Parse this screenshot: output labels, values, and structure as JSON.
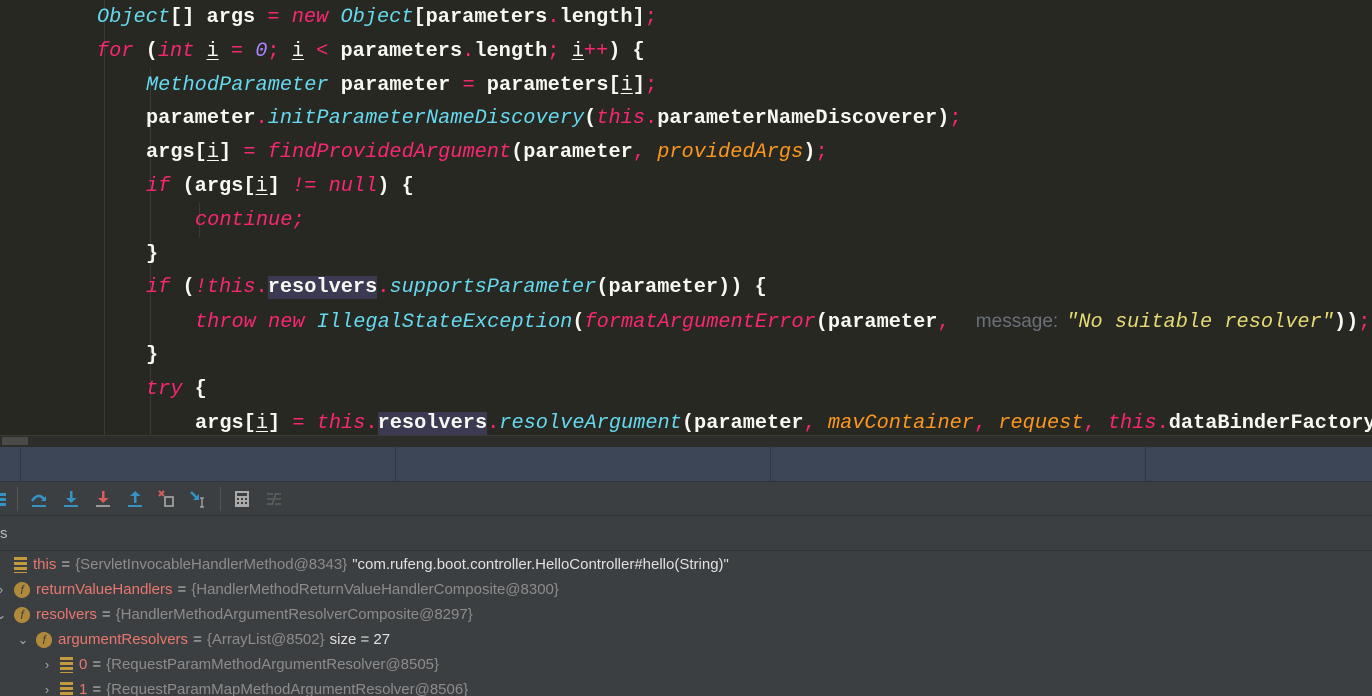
{
  "editor": {
    "lines": [
      {
        "indent": 2,
        "tokens": [
          [
            "t",
            "Object"
          ],
          [
            "",
            "[] args "
          ],
          [
            "o",
            "="
          ],
          [
            "",
            ""
          ],
          [
            "k",
            " new "
          ],
          [
            "t",
            "Object"
          ],
          [
            "",
            "[parameters"
          ],
          [
            "o",
            "."
          ],
          [
            "",
            "length]"
          ],
          [
            "o",
            ";"
          ]
        ]
      },
      {
        "indent": 2,
        "tokens": [
          [
            "k",
            "for"
          ],
          [
            "",
            " ("
          ],
          [
            "k",
            "int "
          ],
          [
            "u",
            "i"
          ],
          [
            "o",
            " = "
          ],
          [
            "n",
            "0"
          ],
          [
            "o",
            "; "
          ],
          [
            "u",
            "i"
          ],
          [
            "o",
            " < "
          ],
          [
            "",
            "parameters"
          ],
          [
            "o",
            "."
          ],
          [
            "",
            "length"
          ],
          [
            "o",
            "; "
          ],
          [
            "u",
            "i"
          ],
          [
            "o",
            "++"
          ],
          [
            "",
            ") {"
          ]
        ]
      },
      {
        "indent": 3,
        "tokens": [
          [
            "t",
            "MethodParameter"
          ],
          [
            "",
            " parameter "
          ],
          [
            "o",
            "="
          ],
          [
            "",
            " parameters["
          ],
          [
            "u",
            "i"
          ],
          [
            "",
            "]"
          ],
          [
            "o",
            ";"
          ]
        ]
      },
      {
        "indent": 3,
        "tokens": [
          [
            "",
            "parameter"
          ],
          [
            "o",
            "."
          ],
          [
            "m",
            "initParameterNameDiscovery"
          ],
          [
            "",
            "("
          ],
          [
            "k",
            "this"
          ],
          [
            "o",
            "."
          ],
          [
            "",
            "parameterNameDiscoverer)"
          ],
          [
            "o",
            ";"
          ]
        ]
      },
      {
        "indent": 3,
        "tokens": [
          [
            "",
            "args["
          ],
          [
            "u",
            "i"
          ],
          [
            "",
            "] "
          ],
          [
            "o",
            "= "
          ],
          [
            "f",
            "findProvidedArgument"
          ],
          [
            "",
            "(parameter"
          ],
          [
            "o",
            ", "
          ],
          [
            "p",
            "providedArgs"
          ],
          [
            "",
            ")"
          ],
          [
            "o",
            ";"
          ]
        ]
      },
      {
        "indent": 3,
        "tokens": [
          [
            "k",
            "if"
          ],
          [
            "",
            " (args["
          ],
          [
            "u",
            "i"
          ],
          [
            "",
            "] "
          ],
          [
            "k",
            "!= null"
          ],
          [
            "",
            ") {"
          ]
        ]
      },
      {
        "indent": 4,
        "tokens": [
          [
            "k",
            "continue;"
          ]
        ]
      },
      {
        "indent": 3,
        "tokens": [
          [
            "",
            "}"
          ]
        ]
      },
      {
        "indent": 3,
        "tokens": [
          [
            "k",
            "if"
          ],
          [
            "",
            " ("
          ],
          [
            "k",
            "!this"
          ],
          [
            "o",
            "."
          ],
          [
            "hl",
            "resolvers"
          ],
          [
            "o",
            "."
          ],
          [
            "m",
            "supportsParameter"
          ],
          [
            "",
            "(parameter)) {"
          ]
        ]
      },
      {
        "indent": 4,
        "tokens": [
          [
            "k",
            "throw new "
          ],
          [
            "t",
            "IllegalStateException"
          ],
          [
            "",
            "("
          ],
          [
            "f",
            "formatArgumentError"
          ],
          [
            "",
            "(parameter"
          ],
          [
            "o",
            ", "
          ],
          [
            "h",
            "message:"
          ],
          [
            "s",
            "\"No suitable resolver\""
          ],
          [
            "",
            "))"
          ],
          [
            "o",
            ";"
          ]
        ]
      },
      {
        "indent": 3,
        "tokens": [
          [
            "",
            "}"
          ]
        ]
      },
      {
        "indent": 3,
        "tokens": [
          [
            "k",
            "try"
          ],
          [
            "",
            " {"
          ]
        ]
      },
      {
        "indent": 4,
        "tokens": [
          [
            "",
            "args["
          ],
          [
            "u",
            "i"
          ],
          [
            "",
            "] "
          ],
          [
            "o",
            "= "
          ],
          [
            "k",
            "this"
          ],
          [
            "o",
            "."
          ],
          [
            "hl",
            "resolvers"
          ],
          [
            "o",
            "."
          ],
          [
            "m",
            "resolveArgument"
          ],
          [
            "",
            "(parameter"
          ],
          [
            "o",
            ", "
          ],
          [
            "p",
            "mavContainer"
          ],
          [
            "o",
            ", "
          ],
          [
            "p",
            "request"
          ],
          [
            "o",
            ", "
          ],
          [
            "k",
            "this"
          ],
          [
            "o",
            "."
          ],
          [
            "",
            "dataBinderFactory)"
          ],
          [
            "o",
            ";"
          ]
        ]
      }
    ]
  },
  "toolbar": {
    "icons": [
      "list-icon",
      "step-over-icon",
      "step-into-icon",
      "force-step-into-icon",
      "step-out-icon",
      "drop-frame-icon",
      "run-to-cursor-icon",
      "evaluate-expression-icon",
      "trace-current-stream-icon"
    ]
  },
  "variables": {
    "header": "s",
    "rows": [
      {
        "depth": 0,
        "chevron": "",
        "icon": "array",
        "name": "this",
        "value": "{ServletInvocableHandlerMethod@8343}",
        "extra": "\"com.rufeng.boot.controller.HelloController#hello(String)\""
      },
      {
        "depth": 0,
        "chevron": "›",
        "icon": "field",
        "name": "returnValueHandlers",
        "value": "{HandlerMethodReturnValueHandlerComposite@8300}",
        "extra": ""
      },
      {
        "depth": 0,
        "chevron": "⌄",
        "icon": "field",
        "name": "resolvers",
        "value": "{HandlerMethodArgumentResolverComposite@8297}",
        "extra": ""
      },
      {
        "depth": 1,
        "chevron": "⌄",
        "icon": "field",
        "name": "argumentResolvers",
        "value": "{ArrayList@8502}",
        "extra": "size = 27"
      },
      {
        "depth": 2,
        "chevron": "›",
        "icon": "array",
        "name": "0",
        "value": "{RequestParamMethodArgumentResolver@8505}",
        "extra": ""
      },
      {
        "depth": 2,
        "chevron": "›",
        "icon": "array",
        "name": "1",
        "value": "{RequestParamMapMethodArgumentResolver@8506}",
        "extra": ""
      }
    ],
    "equals": "=",
    "field_letter": "f"
  },
  "colors": {
    "keyword": "#f92672",
    "type": "#66d9ef",
    "param": "#fd971f",
    "number": "#ae81ff",
    "string": "#e6db74",
    "panel": "#3c3f41"
  }
}
